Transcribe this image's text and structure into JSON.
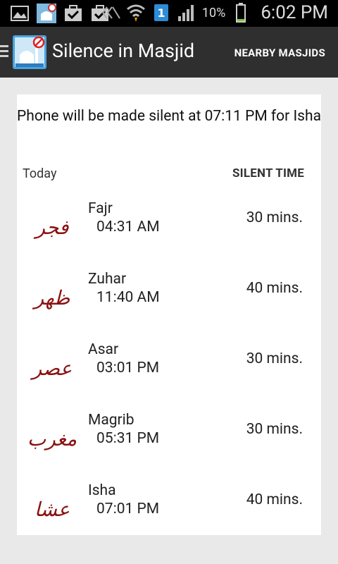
{
  "status_bar": {
    "battery_percent": "10%",
    "clock": "6:02 PM",
    "icons": [
      "gallery-icon",
      "silence-app-icon",
      "download-check-icon",
      "store-check-icon",
      "no-sound-icon",
      "wifi-icon",
      "sim-1-icon",
      "signal-icon",
      "battery-icon"
    ]
  },
  "action_bar": {
    "title": "Silence in Masjid",
    "nearby_label": "NEARBY MASJIDS"
  },
  "notice": "Phone will be made silent at 07:11 PM for Isha",
  "table": {
    "col_today": "Today",
    "col_silent": "SILENT TIME"
  },
  "prayers": [
    {
      "name": "Fajr",
      "time": "04:31 AM",
      "duration": "30 mins.",
      "arabic": "فجر"
    },
    {
      "name": "Zuhar",
      "time": "11:40 AM",
      "duration": "40 mins.",
      "arabic": "ظهر"
    },
    {
      "name": "Asar",
      "time": "03:01 PM",
      "duration": "30 mins.",
      "arabic": "عصر"
    },
    {
      "name": "Magrib",
      "time": "05:31 PM",
      "duration": "30 mins.",
      "arabic": "مغرب"
    },
    {
      "name": "Isha",
      "time": "07:01 PM",
      "duration": "40 mins.",
      "arabic": "عشا"
    }
  ],
  "colors": {
    "calligraphy": "#8b1111",
    "action_bar": "#2f2f2f",
    "background": "#e9e9e9"
  }
}
